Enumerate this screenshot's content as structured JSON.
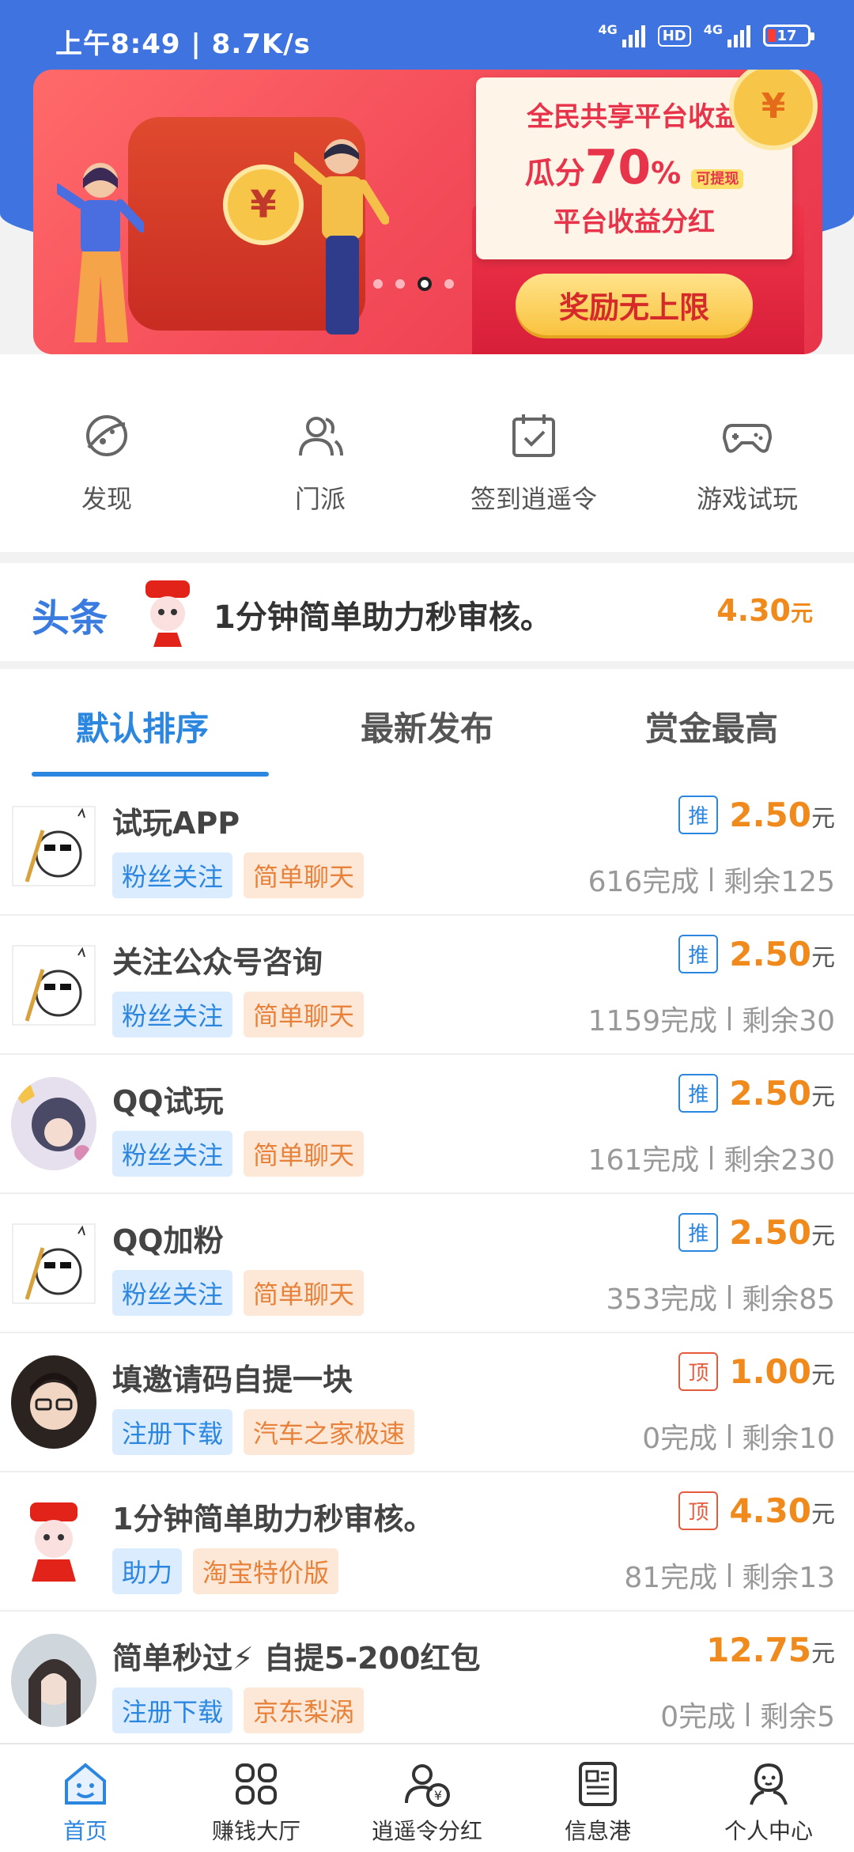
{
  "status": {
    "time": "上午8:49",
    "speed": "8.7K/s",
    "net1": "4G",
    "hd": "HD",
    "net2": "4G",
    "battery": "17"
  },
  "banner": {
    "line1": "全民共享平台收益",
    "line2_prefix": "瓜分",
    "line2_big": "70",
    "line2_suffix": "%",
    "badge": "可提现",
    "line3": "平台收益分红",
    "button": "奖励无上限",
    "coin": "¥",
    "slide_count": 4,
    "active_slide": 3
  },
  "quick": [
    {
      "label": "发现",
      "icon": "planet-icon"
    },
    {
      "label": "门派",
      "icon": "users-icon"
    },
    {
      "label": "签到逍遥令",
      "icon": "calendar-check-icon"
    },
    {
      "label": "游戏试玩",
      "icon": "gamepad-icon"
    }
  ],
  "headline": {
    "tag": "头条",
    "text": "1分钟简单助力秒审核。",
    "price": "4.30",
    "unit": "元"
  },
  "tabs": [
    "默认排序",
    "最新发布",
    "赏金最高"
  ],
  "tasks": [
    {
      "title": "试玩APP",
      "tags": [
        "粉丝关注",
        "简单聊天"
      ],
      "badge": "推",
      "badge_type": "rec",
      "price": "2.50",
      "unit": "元",
      "done": "616完成",
      "left": "剩余125",
      "avatar": "sketch"
    },
    {
      "title": "关注公众号咨询",
      "tags": [
        "粉丝关注",
        "简单聊天"
      ],
      "badge": "推",
      "badge_type": "rec",
      "price": "2.50",
      "unit": "元",
      "done": "1159完成",
      "left": "剩余30",
      "avatar": "sketch"
    },
    {
      "title": "QQ试玩",
      "tags": [
        "粉丝关注",
        "简单聊天"
      ],
      "badge": "推",
      "badge_type": "rec",
      "price": "2.50",
      "unit": "元",
      "done": "161完成",
      "left": "剩余230",
      "avatar": "anime"
    },
    {
      "title": "QQ加粉",
      "tags": [
        "粉丝关注",
        "简单聊天"
      ],
      "badge": "推",
      "badge_type": "rec",
      "price": "2.50",
      "unit": "元",
      "done": "353完成",
      "left": "剩余85",
      "avatar": "sketch"
    },
    {
      "title": "填邀请码自提一块",
      "tags": [
        "注册下载",
        "汽车之家极速"
      ],
      "badge": "顶",
      "badge_type": "top",
      "price": "1.00",
      "unit": "元",
      "done": "0完成",
      "left": "剩余10",
      "avatar": "girl"
    },
    {
      "title": "1分钟简单助力秒审核。",
      "tags": [
        "助力",
        "淘宝特价版"
      ],
      "badge": "顶",
      "badge_type": "top",
      "price": "4.30",
      "unit": "元",
      "done": "81完成",
      "left": "剩余13",
      "avatar": "jd"
    },
    {
      "title": "简单秒过⚡ 自提5-200红包",
      "tags": [
        "注册下载",
        "京东梨涡"
      ],
      "badge": "",
      "badge_type": "",
      "price": "12.75",
      "unit": "元",
      "done": "0完成",
      "left": "剩余5",
      "avatar": "woman"
    }
  ],
  "nav": [
    {
      "label": "首页",
      "icon": "home-icon",
      "active": true
    },
    {
      "label": "赚钱大厅",
      "icon": "grid-icon",
      "active": false
    },
    {
      "label": "逍遥令分红",
      "icon": "dividend-icon",
      "active": false
    },
    {
      "label": "信息港",
      "icon": "news-icon",
      "active": false
    },
    {
      "label": "个人中心",
      "icon": "profile-icon",
      "active": false
    }
  ],
  "colors": {
    "brand_blue": "#3f73e0",
    "accent_orange": "#f08a1c",
    "tab_blue": "#2b86e0"
  }
}
